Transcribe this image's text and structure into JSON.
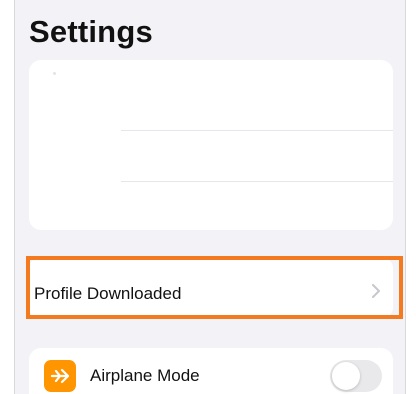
{
  "header": {
    "title": "Settings"
  },
  "account_card": {
    "state": "blank"
  },
  "profile_row": {
    "label": "Profile Downloaded",
    "chevron_icon": "chevron-right-icon",
    "highlight_color": "#f47a1f"
  },
  "airplane_row": {
    "label": "Airplane Mode",
    "icon": "airplane-icon",
    "icon_color": "#ff9500",
    "toggle_state": "off"
  },
  "colors": {
    "background": "#f2f2f7",
    "card": "#ffffff",
    "text": "#111111"
  }
}
